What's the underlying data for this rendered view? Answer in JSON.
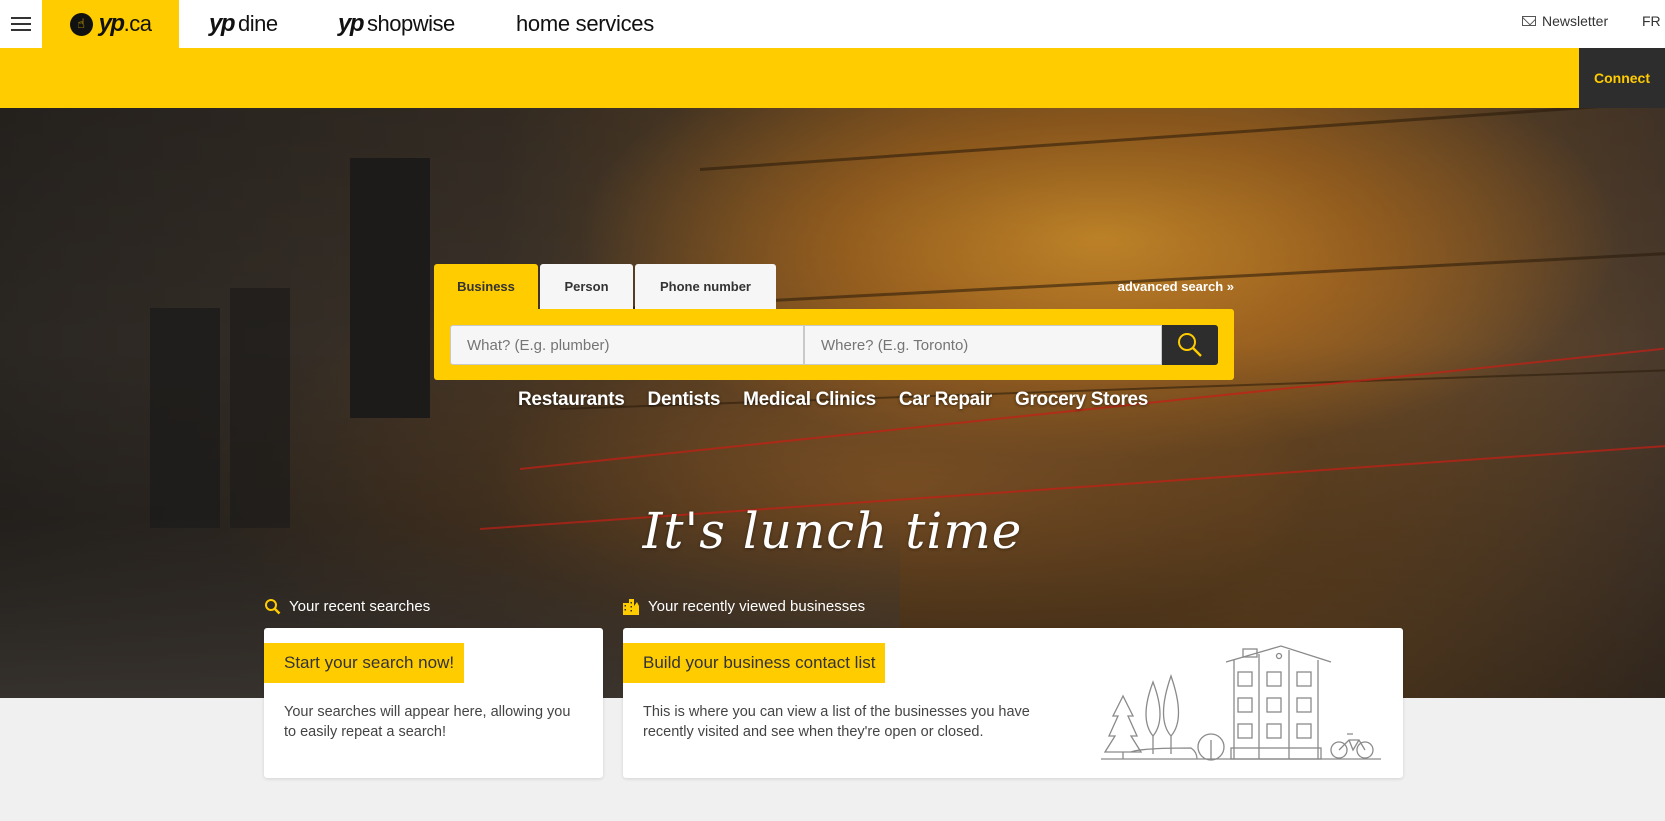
{
  "header": {
    "menu_icon": "hamburger-icon",
    "brands": [
      {
        "prefix": "yp",
        "suffix": ".ca"
      },
      {
        "prefix": "yp",
        "suffix": "dine"
      },
      {
        "prefix": "yp",
        "suffix": "shopwise"
      }
    ],
    "home_services": "home services",
    "newsletter_label": "Newsletter",
    "language_label": "FR",
    "connect_label": "Connect"
  },
  "search": {
    "tabs": [
      {
        "label": "Business",
        "active": true
      },
      {
        "label": "Person",
        "active": false
      },
      {
        "label": "Phone number",
        "active": false
      }
    ],
    "advanced_label": "advanced search »",
    "what_placeholder": "What? (E.g. plumber)",
    "what_value": "",
    "where_placeholder": "Where? (E.g. Toronto)",
    "where_value": "",
    "submit_icon": "search-icon"
  },
  "categories": [
    "Restaurants",
    "Dentists",
    "Medical Clinics",
    "Car Repair",
    "Grocery Stores"
  ],
  "headline": "It's lunch time",
  "recent_searches": {
    "label": "Your recent searches",
    "title": "Start your search now!",
    "body": "Your searches will appear here, allowing you to easily repeat a search!"
  },
  "recently_viewed": {
    "label": "Your recently viewed businesses",
    "title": "Build your business contact list",
    "body": "This is where you can view a list of the businesses you have recently visited and see when they're open or closed."
  },
  "colors": {
    "brand_yellow": "#ffcc00",
    "dark": "#2d2d2d",
    "page_bg": "#f0f0f0"
  }
}
